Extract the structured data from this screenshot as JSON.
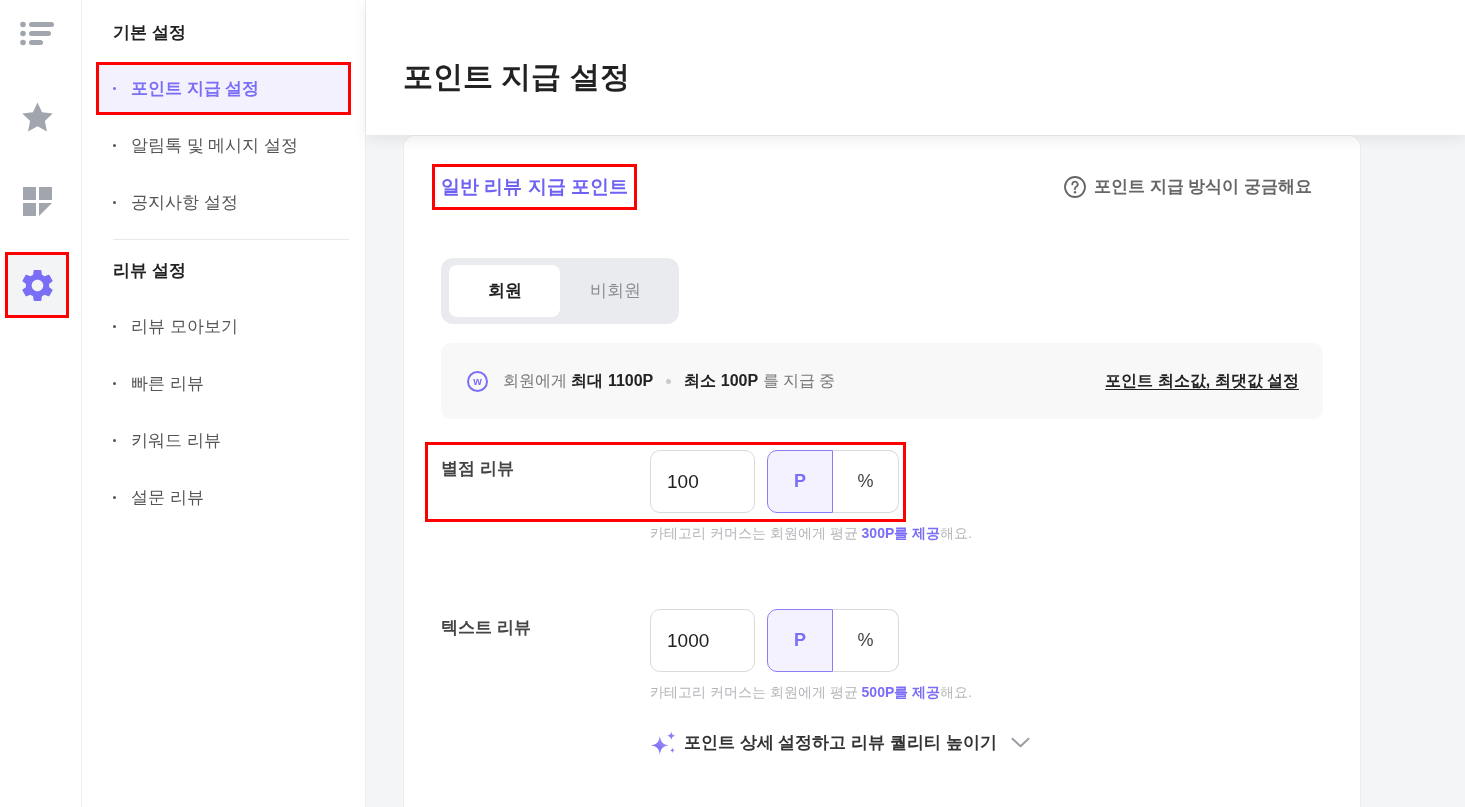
{
  "rail": [
    {
      "kind": "list",
      "selected": false,
      "highlight": false
    },
    {
      "kind": "star",
      "selected": false,
      "highlight": false
    },
    {
      "kind": "dashboard",
      "selected": false,
      "highlight": false
    },
    {
      "kind": "gear",
      "selected": true,
      "highlight": true
    }
  ],
  "sidebar": {
    "groups": [
      {
        "title": "기본 설정",
        "items": [
          {
            "label": "포인트 지급 설정",
            "selected": true,
            "highlight": true
          },
          {
            "label": "알림톡 및 메시지 설정",
            "selected": false,
            "highlight": false
          },
          {
            "label": "공지사항 설정",
            "selected": false,
            "highlight": false
          }
        ]
      },
      {
        "title": "리뷰 설정",
        "items": [
          {
            "label": "리뷰 모아보기",
            "selected": false,
            "highlight": false
          },
          {
            "label": "빠른 리뷰",
            "selected": false,
            "highlight": false
          },
          {
            "label": "키워드 리뷰",
            "selected": false,
            "highlight": false
          },
          {
            "label": "설문 리뷰",
            "selected": false,
            "highlight": false
          }
        ]
      }
    ]
  },
  "header": {
    "title": "포인트 지급 설정"
  },
  "section": {
    "title": "일반 리뷰 지급 포인트",
    "highlight": true,
    "help_link": "포인트 지급 방식이 궁금해요"
  },
  "audience_tabs": [
    {
      "label": "회원",
      "selected": true
    },
    {
      "label": "비회원",
      "selected": false
    }
  ],
  "info": {
    "badge": "w",
    "parts": [
      "회원에게 **최대 1100P**",
      "**최소 100P** 를 지급 중"
    ],
    "link": "포인트 최소값, 최댓값 설정"
  },
  "rows": [
    {
      "label": "별점 리뷰",
      "value": "100",
      "highlight": true,
      "units": [
        {
          "label": "P",
          "selected": true
        },
        {
          "label": "%",
          "selected": false
        }
      ],
      "hint": "카테고리 커머스는 회원에게 평균 **300P를 제공**해요."
    },
    {
      "label": "텍스트 리뷰",
      "value": "1000",
      "highlight": false,
      "units": [
        {
          "label": "P",
          "selected": true
        },
        {
          "label": "%",
          "selected": false
        }
      ],
      "hint": "카테고리 커머스는 회원에게 평균 **500P를 제공**해요."
    }
  ],
  "expander": {
    "label": "포인트 상세 설정하고 리뷰 퀄리티 높이기",
    "expanded": false
  }
}
